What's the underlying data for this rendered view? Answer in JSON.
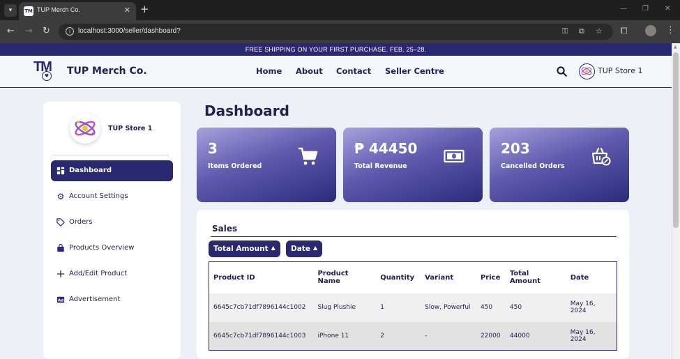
{
  "browser": {
    "tab_title": "TUP Merch Co.",
    "favicon_text": "TM",
    "url": "localhost:3000/seller/dashboard?"
  },
  "banner": {
    "text": "FREE SHIPPING ON YOUR FIRST PURCHASE. FEB. 25–28."
  },
  "header": {
    "brand": "TUP Merch Co.",
    "logo_text": "TM",
    "nav": [
      "Home",
      "About",
      "Contact",
      "Seller Centre"
    ],
    "store_name": "TUP Store 1"
  },
  "sidebar": {
    "store_name": "TUP Store 1",
    "items": [
      {
        "label": "Dashboard",
        "icon": "dashboard-icon",
        "active": true
      },
      {
        "label": "Account Settings",
        "icon": "gear-icon"
      },
      {
        "label": "Orders",
        "icon": "tag-icon"
      },
      {
        "label": "Products Overview",
        "icon": "bag-icon"
      },
      {
        "label": "Add/Edit Product",
        "icon": "plus-icon"
      },
      {
        "label": "Advertisement",
        "icon": "ad-icon"
      }
    ]
  },
  "main": {
    "title": "Dashboard",
    "cards": [
      {
        "value": "3",
        "label": "Items Ordered",
        "icon": "cart-icon"
      },
      {
        "value": "₱ 44450",
        "label": "Total Revenue",
        "icon": "money-icon"
      },
      {
        "value": "203",
        "label": "Cancelled Orders",
        "icon": "cancelled-basket-icon"
      }
    ],
    "sales": {
      "title": "Sales",
      "sort_buttons": [
        "Total Amount",
        "Date"
      ],
      "columns": [
        "Product ID",
        "Product Name",
        "Quantity",
        "Variant",
        "Price",
        "Total Amount",
        "Date"
      ],
      "rows": [
        [
          "6645c7cb71df7896144c1002",
          "Slug Plushie",
          "1",
          "Slow, Powerful",
          "450",
          "450",
          "May 16, 2024"
        ],
        [
          "6645c7cb71df7896144c1003",
          "iPhone 11",
          "2",
          "-",
          "22000",
          "44000",
          "May 16, 2024"
        ]
      ]
    }
  },
  "colors": {
    "primary": "#2a2870",
    "background": "#eef0f8",
    "card_gradient_start": "#a6a1dc",
    "card_gradient_end": "#2d2a7c"
  }
}
